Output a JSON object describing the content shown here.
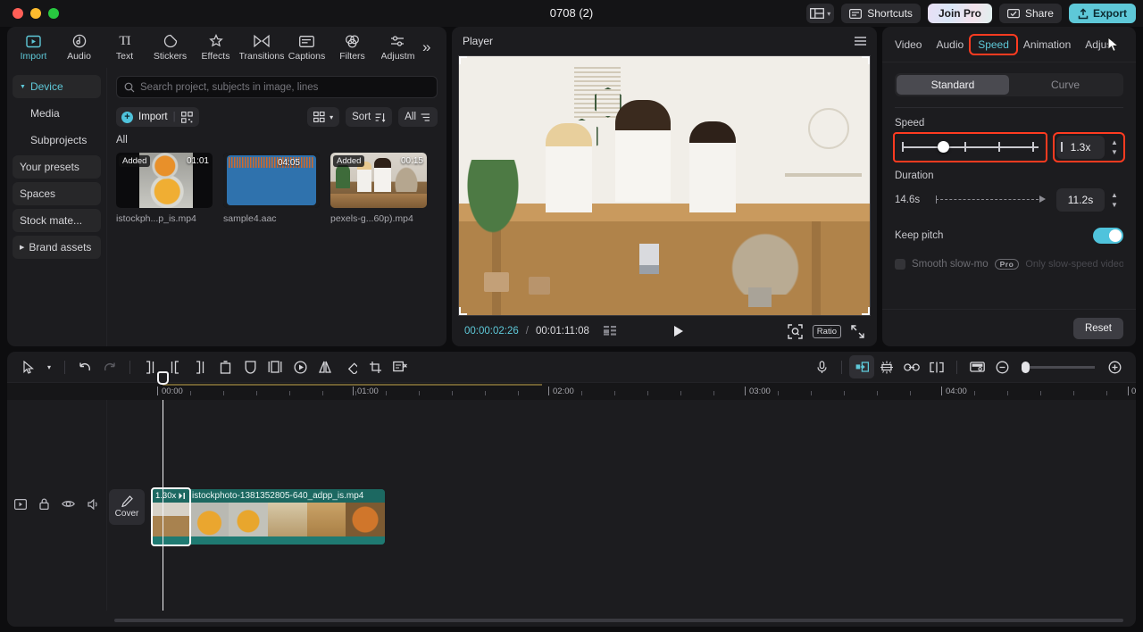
{
  "window": {
    "title": "0708 (2)"
  },
  "titlebar": {
    "layout_icon": "layout-icon",
    "chevron": "chevron-down-icon",
    "shortcuts_label": "Shortcuts",
    "shortcuts_icon": "keyboard-icon",
    "join_pro_label": "Join Pro",
    "share_label": "Share",
    "share_icon": "share-icon",
    "export_label": "Export",
    "export_icon": "upload-icon",
    "export_color": "#5ec8d8"
  },
  "toolstrip": {
    "items": [
      {
        "label": "Import",
        "icon": "import-icon",
        "active": true
      },
      {
        "label": "Audio",
        "icon": "audio-note-icon",
        "active": false
      },
      {
        "label": "Text",
        "icon": "text-ti-icon",
        "active": false
      },
      {
        "label": "Stickers",
        "icon": "sticker-icon",
        "active": false
      },
      {
        "label": "Effects",
        "icon": "sparkle-icon",
        "active": false
      },
      {
        "label": "Transitions",
        "icon": "transition-icon",
        "active": false
      },
      {
        "label": "Captions",
        "icon": "captions-icon",
        "active": false
      },
      {
        "label": "Filters",
        "icon": "filters-icon",
        "active": false
      },
      {
        "label": "Adjustm",
        "icon": "adjust-sliders-icon",
        "active": false
      }
    ],
    "more_icon": "chevron-double-right-icon"
  },
  "sidebar": {
    "items": [
      {
        "label": "Device",
        "type": "group",
        "expanded": true,
        "selected": true
      },
      {
        "label": "Media",
        "type": "child"
      },
      {
        "label": "Subprojects",
        "type": "child"
      },
      {
        "label": "Your presets",
        "type": "item"
      },
      {
        "label": "Spaces",
        "type": "item"
      },
      {
        "label": "Stock mate...",
        "type": "item"
      },
      {
        "label": "Brand assets",
        "type": "group",
        "expanded": false
      }
    ]
  },
  "media": {
    "search_placeholder": "Search project, subjects in image, lines",
    "search_value": "",
    "search_icon": "search-icon",
    "import_label": "Import",
    "import_grid_icon": "qr-grid-icon",
    "view_icon": "grid-view-icon",
    "view_chevron": "chevron-down-icon",
    "sort_label": "Sort",
    "sort_icon": "sort-icon",
    "all_label": "All",
    "filter_icon": "filter-icon",
    "section_label": "All",
    "tiles": [
      {
        "name": "istockph...p_is.mp4",
        "duration": "01:01",
        "badge": "Added",
        "thumb": "food"
      },
      {
        "name": "sample4.aac",
        "duration": "04:05",
        "badge": "",
        "thumb": "waveform"
      },
      {
        "name": "pexels-g...60p).mp4",
        "duration": "00:15",
        "badge": "Added",
        "thumb": "people"
      }
    ]
  },
  "player": {
    "title": "Player",
    "menu_icon": "hamburger-icon",
    "current_time": "00:00:02:26",
    "separator": "/",
    "total_time": "00:01:11:08",
    "list_icon": "list-icon",
    "play_icon": "play-icon",
    "zoom_icon": "zoom-fit-icon",
    "ratio_label": "Ratio",
    "fullscreen_icon": "fullscreen-icon"
  },
  "inspector": {
    "tabs": [
      {
        "label": "Video",
        "active": false,
        "highlighted": false
      },
      {
        "label": "Audio",
        "active": false,
        "highlighted": false
      },
      {
        "label": "Speed",
        "active": true,
        "highlighted": true
      },
      {
        "label": "Animation",
        "active": false,
        "highlighted": false
      },
      {
        "label": "Adjust",
        "active": false,
        "highlighted": false
      }
    ],
    "mode_standard": "Standard",
    "mode_curve": "Curve",
    "mode_selected": "Standard",
    "speed_label": "Speed",
    "speed_value": "1.3x",
    "duration_label": "Duration",
    "duration_original": "14.6s",
    "duration_value": "11.2s",
    "keep_pitch_label": "Keep pitch",
    "keep_pitch_on": true,
    "smooth_slowmo_label": "Smooth slow-mo",
    "pro_badge": "Pro",
    "smooth_hint": "Only slow-speed videos ar",
    "reset_label": "Reset",
    "highlight_color": "#ff3b20",
    "accent_color": "#5ec8d8"
  },
  "timeline": {
    "tools": [
      {
        "icon": "select-arrow-icon",
        "name": "select-tool",
        "state": "normal"
      },
      {
        "icon": "chevron-down-icon",
        "name": "select-tool-dropdown",
        "state": "normal"
      },
      {
        "icon": "undo-icon",
        "name": "undo-button",
        "state": "normal"
      },
      {
        "icon": "redo-icon",
        "name": "redo-button",
        "state": "dim"
      },
      {
        "icon": "split-left-icon",
        "name": "trim-left-button",
        "state": "normal"
      },
      {
        "icon": "split-icon",
        "name": "split-button",
        "state": "normal"
      },
      {
        "icon": "split-right-icon",
        "name": "trim-right-button",
        "state": "normal"
      },
      {
        "icon": "delete-icon",
        "name": "delete-button",
        "state": "normal"
      },
      {
        "icon": "mask-icon",
        "name": "mask-button",
        "state": "normal"
      },
      {
        "icon": "freeze-frame-icon",
        "name": "freeze-frame-button",
        "state": "normal"
      },
      {
        "icon": "reverse-icon",
        "name": "reverse-button",
        "state": "normal"
      },
      {
        "icon": "mirror-icon",
        "name": "mirror-button",
        "state": "normal"
      },
      {
        "icon": "rotate-icon",
        "name": "rotate-button",
        "state": "normal"
      },
      {
        "icon": "crop-icon",
        "name": "crop-button",
        "state": "normal"
      },
      {
        "icon": "remove-caption-icon",
        "name": "remove-caption-button",
        "state": "normal"
      }
    ],
    "right_tools": [
      {
        "icon": "microphone-icon",
        "name": "record-voiceover-button",
        "state": "normal"
      },
      {
        "icon": "auto-fit-icon",
        "name": "auto-fit-button",
        "state": "on"
      },
      {
        "icon": "magnetic-icon",
        "name": "magnetic-snap-button",
        "state": "normal"
      },
      {
        "icon": "link-icon",
        "name": "link-clips-button",
        "state": "normal"
      },
      {
        "icon": "adsorb-icon",
        "name": "snap-button",
        "state": "normal"
      },
      {
        "icon": "thumbnail-view-icon",
        "name": "thumbnail-view-button",
        "state": "normal"
      }
    ],
    "zoom_out_icon": "zoom-out-icon",
    "zoom_in_icon": "zoom-in-icon",
    "ruler_labels": [
      "00:00",
      "01:00",
      "02:00",
      "03:00",
      "04:00",
      "0"
    ],
    "track_icons": [
      {
        "icon": "track-type-icon",
        "name": "track-type-icon"
      },
      {
        "icon": "lock-icon",
        "name": "lock-track-button"
      },
      {
        "icon": "eye-icon",
        "name": "hide-track-button"
      },
      {
        "icon": "speaker-icon",
        "name": "mute-track-button"
      },
      {
        "icon": "ellipsis-icon",
        "name": "track-more-button"
      }
    ],
    "cover_label": "Cover",
    "cover_icon": "pen-icon",
    "clip": {
      "name": "istockphoto-1381352805-640_adpp_is.mp4",
      "speed_badge": "1.30x",
      "speed_icon": "speed-arrows-icon"
    }
  }
}
